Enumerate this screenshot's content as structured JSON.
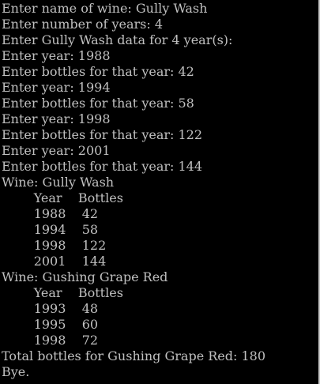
{
  "colors": {
    "background": "#000000",
    "text": "#c0c0c0",
    "right_border": "#c8c8c8"
  },
  "console": {
    "lines": [
      "Enter name of wine: Gully Wash",
      "Enter number of years: 4",
      "Enter Gully Wash data for 4 year(s):",
      "Enter year: 1988",
      "Enter bottles for that year: 42",
      "Enter year: 1994",
      "Enter bottles for that year: 58",
      "Enter year: 1998",
      "Enter bottles for that year: 122",
      "Enter year: 2001",
      "Enter bottles for that year: 144",
      "Wine: Gully Wash",
      "        Year    Bottles",
      "        1988    42",
      "        1994    58",
      "        1998    122",
      "        2001    144",
      "Wine: Gushing Grape Red",
      "        Year    Bottles",
      "        1993    48",
      "        1995    60",
      "        1998    72",
      "Total bottles for Gushing Grape Red: 180",
      "Bye."
    ]
  }
}
